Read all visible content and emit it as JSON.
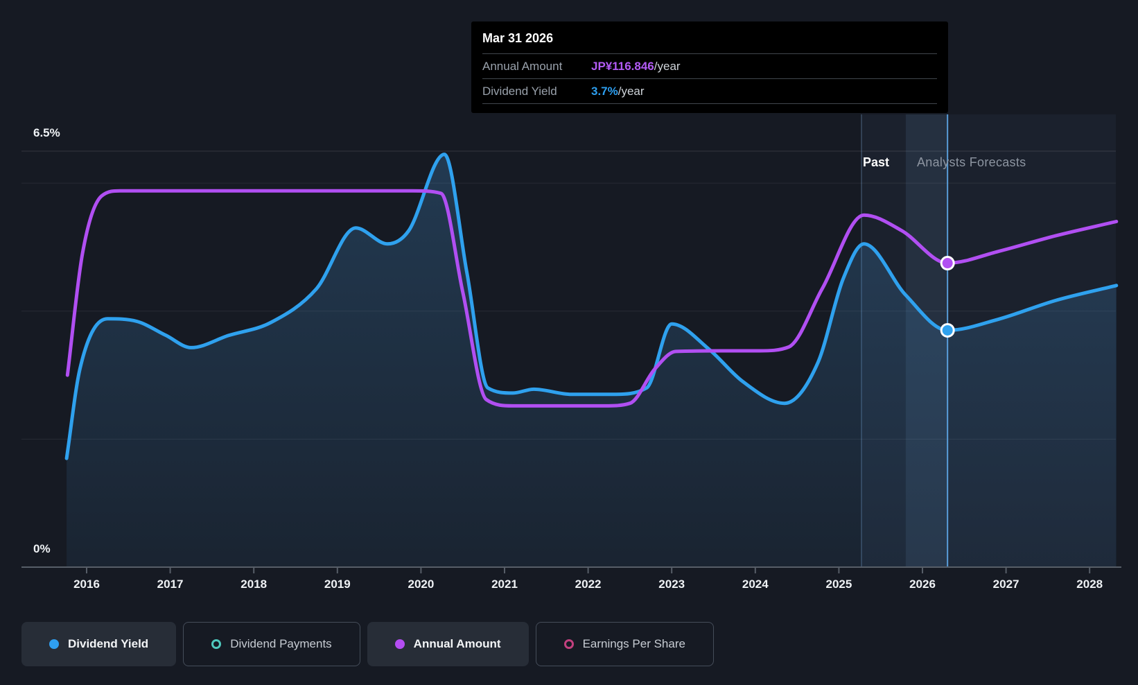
{
  "tooltip": {
    "date": "Mar 31 2026",
    "rows": [
      {
        "label": "Annual Amount",
        "value": "JP¥116.846",
        "suffix": "/year",
        "color": "#b25bf5"
      },
      {
        "label": "Dividend Yield",
        "value": "3.7%",
        "suffix": "/year",
        "color": "#2d9ff0"
      }
    ]
  },
  "axis_labels": {
    "y_top": "6.5%",
    "y_bottom": "0%",
    "past": "Past",
    "forecasts": "Analysts Forecasts"
  },
  "legend": {
    "items": [
      {
        "label": "Dividend Yield",
        "active": true,
        "marker": "filled",
        "color": "#2f9ff0"
      },
      {
        "label": "Dividend Payments",
        "active": false,
        "marker": "ring",
        "color": "#4fc9be"
      },
      {
        "label": "Annual Amount",
        "active": true,
        "marker": "filled",
        "color": "#b44df2"
      },
      {
        "label": "Earnings Per Share",
        "active": false,
        "marker": "ring",
        "color": "#c2407e"
      }
    ]
  },
  "chart_data": {
    "type": "line",
    "title": "",
    "xlabel": "",
    "ylabel": "",
    "x_ticks": [
      2016,
      2017,
      2018,
      2019,
      2020,
      2021,
      2022,
      2023,
      2024,
      2025,
      2026,
      2027,
      2028
    ],
    "x_range_years": [
      2015.76,
      2028.32
    ],
    "ylim": [
      0,
      6.5
    ],
    "y_gridlines_pct": [
      2,
      4,
      6
    ],
    "y_top_line_pct": 6.5,
    "grid_on": true,
    "past_boundary_x": 2025.27,
    "hover": {
      "x": 2026.3,
      "date": "Mar 31 2026",
      "highlight_band": [
        2025.8,
        2026.3
      ]
    },
    "series": [
      {
        "name": "Dividend Yield",
        "color": "#2fa1ee",
        "style": "area",
        "unit": "%",
        "marker": {
          "x": 2026.3,
          "y": 3.7
        },
        "points": [
          [
            2015.76,
            1.7
          ],
          [
            2015.92,
            3.1
          ],
          [
            2016.25,
            3.88
          ],
          [
            2016.6,
            3.84
          ],
          [
            2016.95,
            3.62
          ],
          [
            2017.25,
            3.43
          ],
          [
            2017.7,
            3.62
          ],
          [
            2018.2,
            3.82
          ],
          [
            2018.75,
            4.35
          ],
          [
            2019.22,
            5.3
          ],
          [
            2019.6,
            5.05
          ],
          [
            2019.85,
            5.25
          ],
          [
            2020.28,
            6.45
          ],
          [
            2020.55,
            4.6
          ],
          [
            2020.8,
            2.8
          ],
          [
            2021.1,
            2.72
          ],
          [
            2021.35,
            2.78
          ],
          [
            2021.8,
            2.7
          ],
          [
            2022.3,
            2.7
          ],
          [
            2022.7,
            2.8
          ],
          [
            2023.0,
            3.8
          ],
          [
            2023.45,
            3.4
          ],
          [
            2023.85,
            2.9
          ],
          [
            2024.35,
            2.56
          ],
          [
            2024.75,
            3.2
          ],
          [
            2025.05,
            4.5
          ],
          [
            2025.3,
            5.05
          ],
          [
            2025.8,
            4.25
          ],
          [
            2026.3,
            3.7
          ],
          [
            2026.9,
            3.87
          ],
          [
            2027.6,
            4.17
          ],
          [
            2028.32,
            4.4
          ]
        ]
      },
      {
        "name": "Annual Amount",
        "color": "#b14ff2",
        "style": "line",
        "unit": "plotted-on-yield-scale",
        "marker": {
          "x": 2026.3,
          "y": 4.75
        },
        "points": [
          [
            2015.77,
            3.0
          ],
          [
            2015.95,
            4.9
          ],
          [
            2016.18,
            5.8
          ],
          [
            2016.4,
            5.88
          ],
          [
            2017.0,
            5.88
          ],
          [
            2018.0,
            5.88
          ],
          [
            2019.0,
            5.88
          ],
          [
            2019.9,
            5.88
          ],
          [
            2020.24,
            5.84
          ],
          [
            2020.5,
            4.3
          ],
          [
            2020.78,
            2.62
          ],
          [
            2021.1,
            2.52
          ],
          [
            2021.7,
            2.52
          ],
          [
            2022.2,
            2.52
          ],
          [
            2022.5,
            2.56
          ],
          [
            2022.8,
            3.1
          ],
          [
            2023.05,
            3.37
          ],
          [
            2023.6,
            3.38
          ],
          [
            2024.05,
            3.38
          ],
          [
            2024.4,
            3.44
          ],
          [
            2024.8,
            4.35
          ],
          [
            2025.3,
            5.5
          ],
          [
            2025.75,
            5.26
          ],
          [
            2026.3,
            4.75
          ],
          [
            2026.9,
            4.93
          ],
          [
            2027.6,
            5.18
          ],
          [
            2028.32,
            5.4
          ]
        ]
      }
    ],
    "colors": {
      "background": "#161a23",
      "gridline": "rgba(255,255,255,0.08)",
      "top_line": "rgba(255,255,255,0.13)",
      "axis_line": "#575e68",
      "area_fill_top": "rgba(70,150,215,0.26)",
      "area_fill_bottom": "rgba(70,150,215,0.08)",
      "forecast_tint": "rgba(130,185,240,0.05)",
      "highlight_band": "rgba(130,185,240,0.10)",
      "divider_line": "rgba(150,200,255,0.28)",
      "hover_line": "rgba(95,170,235,0.9)"
    }
  }
}
